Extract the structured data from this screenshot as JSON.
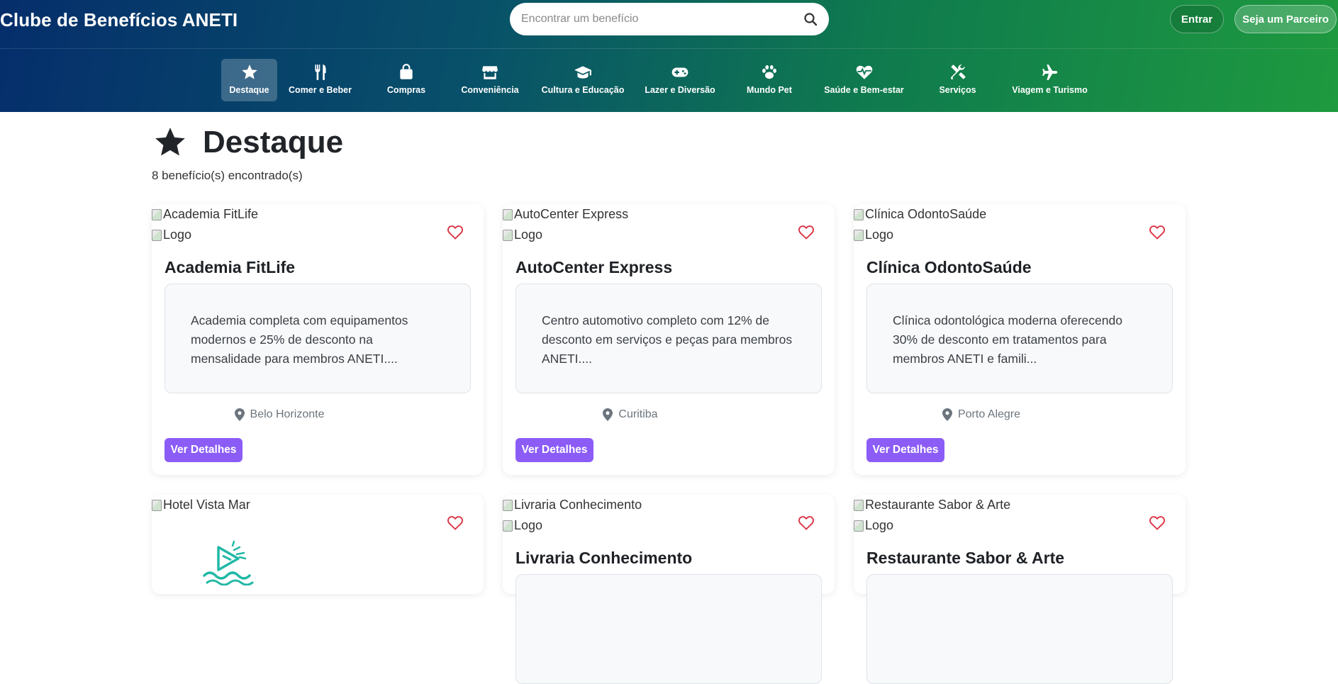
{
  "header": {
    "brand": "Clube de Benefícios ANETI",
    "search_placeholder": "Encontrar um benefício",
    "search_icon": "search-icon",
    "login_label": "Entrar",
    "partner_label": "Seja um Parceiro"
  },
  "categories": [
    {
      "label": "Destaque",
      "icon": "star-icon",
      "active": true
    },
    {
      "label": "Comer e Beber",
      "icon": "utensils-icon",
      "active": false
    },
    {
      "label": "Compras",
      "icon": "shopping-bag-icon",
      "active": false
    },
    {
      "label": "Conveniência",
      "icon": "store-icon",
      "active": false
    },
    {
      "label": "Cultura e Educação",
      "icon": "graduation-cap-icon",
      "active": false
    },
    {
      "label": "Lazer e Diversão",
      "icon": "gamepad-icon",
      "active": false
    },
    {
      "label": "Mundo Pet",
      "icon": "paw-icon",
      "active": false
    },
    {
      "label": "Saúde e Bem-estar",
      "icon": "heart-pulse-icon",
      "active": false
    },
    {
      "label": "Serviços",
      "icon": "tools-icon",
      "active": false
    },
    {
      "label": "Viagem e Turismo",
      "icon": "plane-icon",
      "active": false
    }
  ],
  "page": {
    "title": "Destaque",
    "count_text": "8 benefício(s) encontrado(s)"
  },
  "cards": [
    {
      "banner_alt": "Academia FitLife",
      "logo_alt": "Logo",
      "title": "Academia FitLife",
      "description": "Academia completa com equipamentos modernos e 25% de desconto na mensalidade para membros ANETI....",
      "location": "Belo Horizonte",
      "button": "Ver Detalhes"
    },
    {
      "banner_alt": "AutoCenter Express",
      "logo_alt": "Logo",
      "title": "AutoCenter Express",
      "description": "Centro automotivo completo com 12% de desconto em serviços e peças para membros ANETI....",
      "location": "Curitiba",
      "button": "Ver Detalhes"
    },
    {
      "banner_alt": "Clínica OdontoSaúde",
      "logo_alt": "Logo",
      "title": "Clínica OdontoSaúde",
      "description": "Clínica odontológica moderna oferecendo 30% de desconto em tratamentos para membros ANETI e famili...",
      "location": "Porto Alegre",
      "button": "Ver Detalhes"
    },
    {
      "banner_alt": "Hotel Vista Mar"
    },
    {
      "banner_alt": "Livraria Conhecimento",
      "logo_alt": "Logo",
      "title": "Livraria Conhecimento"
    },
    {
      "banner_alt": "Restaurante Sabor & Arte",
      "logo_alt": "Logo",
      "title": "Restaurante Sabor & Arte"
    }
  ],
  "colors": {
    "accent": "#8b5cf6",
    "heart": "#dc3545"
  }
}
